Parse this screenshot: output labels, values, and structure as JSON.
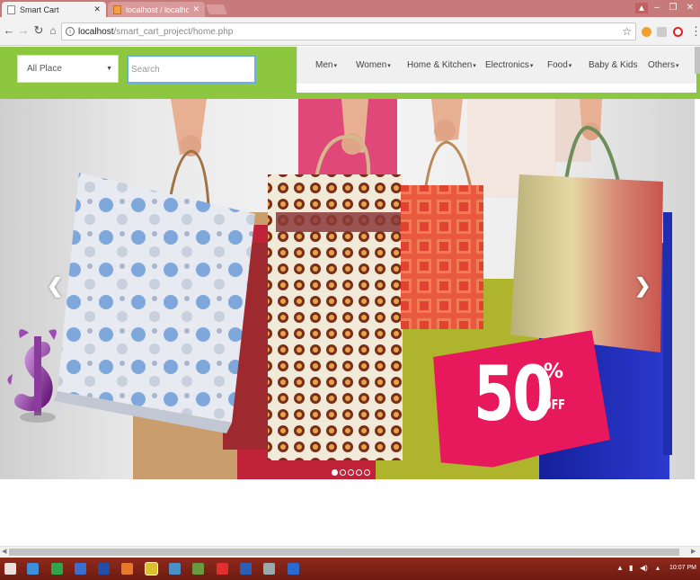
{
  "browser": {
    "tabs": [
      {
        "title": "Smart Cart",
        "active": true
      },
      {
        "title": "localhost / localhost | php",
        "active": false
      }
    ],
    "url_host": "localhost",
    "url_path": "/smart_cart_project/home.php"
  },
  "header": {
    "place_select": "All Place",
    "search_placeholder": "Search",
    "categories": [
      {
        "label": "Men"
      },
      {
        "label": "Women"
      },
      {
        "label": "Home & Kitchen"
      },
      {
        "label": "Electronics"
      },
      {
        "label": "Food"
      },
      {
        "label": "Baby & Kids"
      },
      {
        "label": "Others"
      }
    ]
  },
  "carousel": {
    "promo_value": "50",
    "promo_percent": "%",
    "promo_off": "OFF",
    "slide_count": 5,
    "active_slide": 1
  },
  "taskbar": {
    "clock": "10:07 PM"
  },
  "colors": {
    "header_green": "#8dc63f",
    "promo_pink": "#e8185c",
    "taskbar": "#7a1f14"
  }
}
